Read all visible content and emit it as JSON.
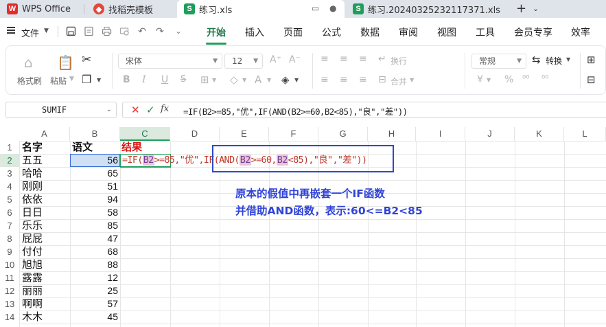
{
  "tabs": [
    {
      "label": "WPS Office",
      "logo": "W"
    },
    {
      "label": "找稻壳模板",
      "logo": ""
    },
    {
      "label": "练习.xls",
      "logo": "S"
    },
    {
      "label": "练习.20240325232117371.xls",
      "logo": "S"
    }
  ],
  "menu": {
    "file": "文件",
    "items": [
      "开始",
      "插入",
      "页面",
      "公式",
      "数据",
      "审阅",
      "视图",
      "工具",
      "会员专享",
      "效率"
    ],
    "active": "开始"
  },
  "ribbon": {
    "format_painter": "格式刷",
    "paste": "粘贴",
    "font_name": "宋体",
    "font_size": "12",
    "wrap": "换行",
    "merge": "合并",
    "number_format": "常规",
    "convert": "转换",
    "bold": "B",
    "italic": "I",
    "underline": "U",
    "increase_font": "A⁺",
    "decrease_font": "A⁻",
    "yen": "¥",
    "percent": "%"
  },
  "formula_bar": {
    "name_box": "SUMIF",
    "fx": "fx",
    "formula": "=IF(B2>=85,\"优\",IF(AND(B2>=60,B2<85),\"良\",\"差\"))"
  },
  "grid": {
    "columns": [
      "A",
      "B",
      "C",
      "D",
      "E",
      "F",
      "G",
      "H",
      "I",
      "J",
      "K",
      "L"
    ],
    "selected_column": "C",
    "rows": [
      "1",
      "2",
      "3",
      "4",
      "5",
      "6",
      "7",
      "8",
      "9",
      "10",
      "11",
      "12",
      "13",
      "14"
    ],
    "selected_row": "2",
    "header": {
      "A": "名字",
      "B": "语文",
      "C": "结果"
    },
    "data": [
      {
        "name": "五五",
        "score": "56"
      },
      {
        "name": "哈哈",
        "score": "65"
      },
      {
        "name": "刚刚",
        "score": "51"
      },
      {
        "name": "依依",
        "score": "94"
      },
      {
        "name": "日日",
        "score": "58"
      },
      {
        "name": "乐乐",
        "score": "85"
      },
      {
        "name": "屁屁",
        "score": "47"
      },
      {
        "name": "付付",
        "score": "68"
      },
      {
        "name": "旭旭",
        "score": "88"
      },
      {
        "name": "露露",
        "score": "12"
      },
      {
        "name": "丽丽",
        "score": "25"
      },
      {
        "name": "啊啊",
        "score": "57"
      },
      {
        "name": "木木",
        "score": "45"
      }
    ],
    "incell_formula": {
      "p1": "=IF(",
      "r1": "B2",
      "p2": ">=85,\"优\",IF(AND(",
      "r2": "B2",
      "p3": ">=60,",
      "r3": "B2",
      "p4": "<85),\"良\",\"差\"))"
    }
  },
  "annotation": {
    "line1": "原本的假值中再嵌套一个IF函数",
    "line2": "并借助AND函数，表示:60<=B2<85"
  },
  "colors": {
    "accent": "#1f9e5b",
    "note": "#2f43d8",
    "box": "#2e49c7",
    "formula_text": "#c0392b"
  }
}
